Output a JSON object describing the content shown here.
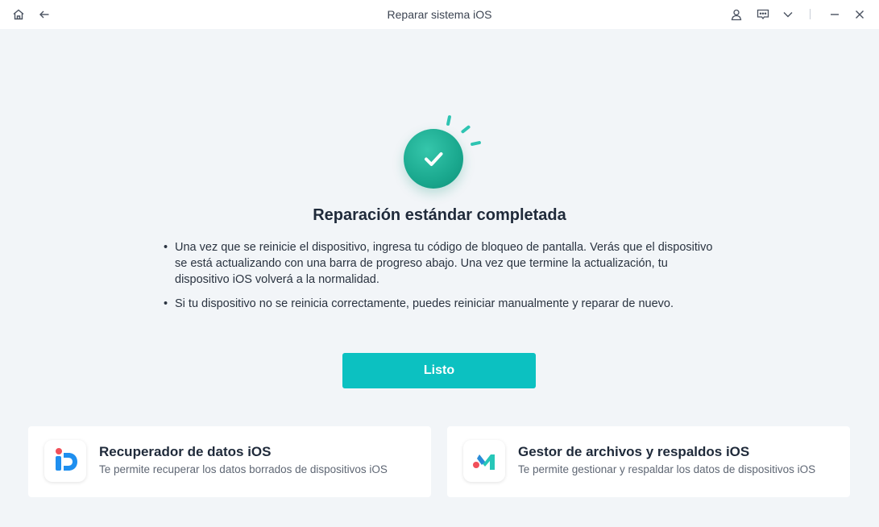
{
  "window": {
    "title": "Reparar sistema iOS",
    "icons": [
      "home-icon",
      "back-arrow-icon",
      "user-icon",
      "feedback-icon",
      "chevron-down-icon",
      "minimize-icon",
      "close-icon"
    ]
  },
  "result": {
    "heading": "Reparación estándar completada",
    "bullet_glyph": "•",
    "bullets": [
      "Una vez que se reinicie el dispositivo, ingresa tu código de bloqueo de pantalla. Verás que el dispositivo se está actualizando con una barra de progreso abajo. Una vez que termine la actualización, tu dispositivo iOS volverá a la normalidad.",
      "Si tu dispositivo no se reinicia correctamente, puedes reiniciar manualmente y reparar de nuevo."
    ],
    "done_label": "Listo"
  },
  "products": [
    {
      "title": "Recuperador de datos iOS",
      "description": "Te permite recuperar los datos borrados de dispositivos iOS",
      "icon": "data-recovery-logo-icon"
    },
    {
      "title": "Gestor de archivos y respaldos iOS",
      "description": "Te permite gestionar y respaldar los datos de dispositivos iOS",
      "icon": "file-manager-logo-icon"
    }
  ],
  "colors": {
    "accent": "#0cc1c1",
    "success": "#1aa88e",
    "background": "#f2f5f8",
    "text": "#1f2a3a"
  }
}
